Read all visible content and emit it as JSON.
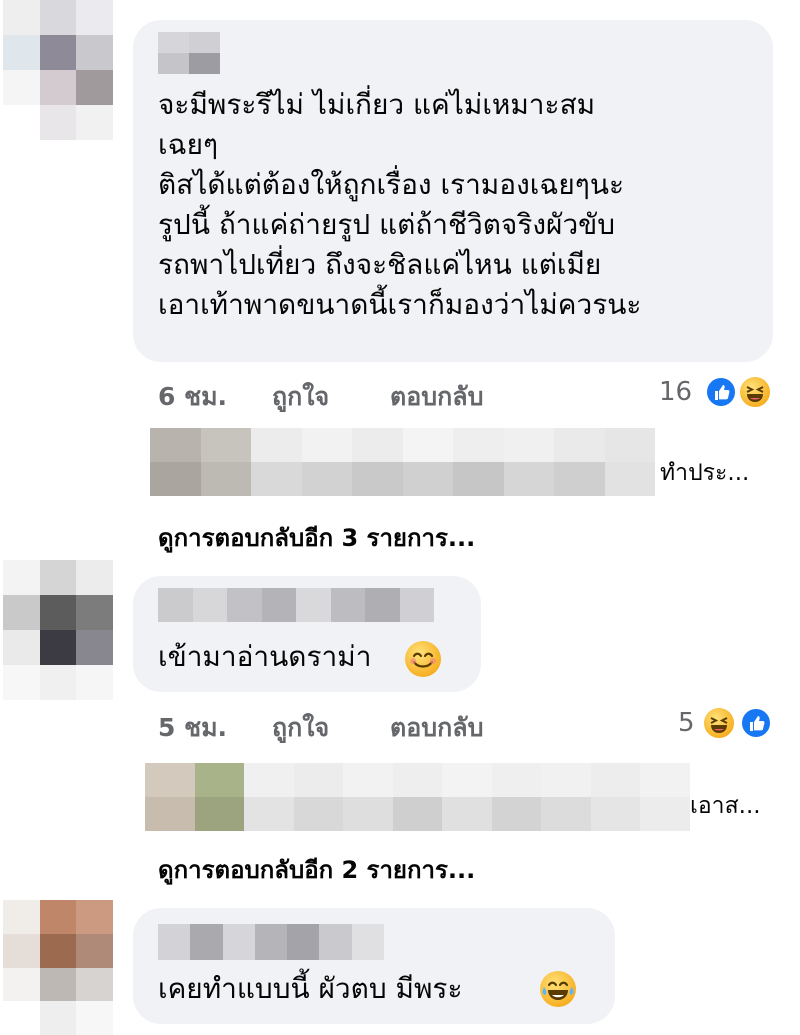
{
  "comments": [
    {
      "lines": [
        "จะมีพระรึไม่ ไม่เกี่ยว แค่ไม่เหมาะสม",
        "เฉยๆ",
        "ติสได้แต่ต้องให้ถูกเรื่อง เรามองเฉยๆนะ",
        "รูปนี้ ถ้าแค่ถ่ายรูป  แต่ถ้าชีวิตจริงผัวขับ",
        "รถพาไปเที่ยว ถึงจะชิลแค่ไหน แต่เมีย",
        "เอาเท้าพาดขนาดนี้เราก็มองว่าไม่ควรนะ"
      ],
      "time": "6 ชม.",
      "like_label": "ถูกใจ",
      "reply_label": "ตอบกลับ",
      "reaction_count": "16",
      "reply_preview": "ทำประ...",
      "more_replies": "ดูการตอบกลับอีก 3 รายการ..."
    },
    {
      "lines": [
        "เข้ามาอ่านดราม่า"
      ],
      "time": "5 ชม.",
      "like_label": "ถูกใจ",
      "reply_label": "ตอบกลับ",
      "reaction_count": "5",
      "reply_preview": "เอาส...",
      "more_replies": "ดูการตอบกลับอีก 2 รายการ..."
    },
    {
      "lines": [
        "เคยทำแบบนี้ ผัวตบ มีพระ"
      ]
    }
  ],
  "icons": {
    "like": "like-reaction-icon",
    "haha": "haha-reaction-icon",
    "smile": "smiling-face-emoji",
    "joy": "tears-of-joy-emoji"
  },
  "colors": {
    "bubble": "#f0f2f5",
    "meta_text": "#65676b",
    "like_blue": "#1877f2"
  }
}
